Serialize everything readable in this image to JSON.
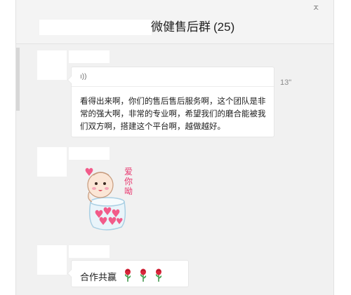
{
  "chat": {
    "title_suffix": "微健售后群",
    "member_count": "(25)",
    "pin_glyph": "ㅈ"
  },
  "messages": [
    {
      "type": "voice",
      "voice_icon": "ı))",
      "duration": "13\"",
      "transcript": "看得出来啊，你们的售后售后服务啊，这个团队是非常的强大啊，非常的专业啊，希望我们的磨合能被我们双方啊，搭建这个平台啊，越做越好。"
    },
    {
      "type": "sticker",
      "sticker_caption": "爱你呦",
      "icon": "baby-heart-jar-sticker"
    },
    {
      "type": "text",
      "text": "合作共赢",
      "emoji": [
        "rose",
        "rose",
        "rose"
      ]
    }
  ],
  "colors": {
    "chat_bg": "#f1f1f1",
    "bubble_bg": "#ffffff",
    "caption_pink": "#e8386f"
  }
}
